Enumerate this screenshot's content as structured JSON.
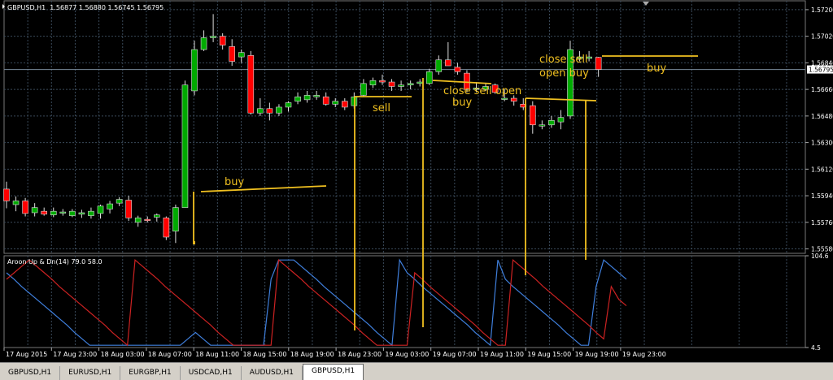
{
  "window": {
    "symbol_header": "GBPUSD,H1",
    "ohlc_header": "1.56877 1.56880 1.56745 1.56795",
    "indicator_header": "Aroon Up & Dn(14) 79.0 58.0",
    "current_price": "1.56795"
  },
  "colors": {
    "background": "#000000",
    "grid": "#3a4a5a",
    "bull": "#00aa00",
    "bear": "#ff0000",
    "aroon_up": "#3f7fdc",
    "aroon_down": "#cc2222",
    "annotation": "#f0c020",
    "text": "#ffffff"
  },
  "chart_data": [
    {
      "type": "candlestick",
      "price_axis_labels": [
        "1.57200",
        "1.57020",
        "1.56840",
        "1.56660",
        "1.56480",
        "1.56300",
        "1.56120",
        "1.55940",
        "1.55760",
        "1.55580"
      ],
      "ylim": [
        1.5555,
        1.5726
      ],
      "time_axis_labels": [
        "17 Aug 2015",
        "17 Aug 23:00",
        "18 Aug 03:00",
        "18 Aug 07:00",
        "18 Aug 11:00",
        "18 Aug 15:00",
        "18 Aug 19:00",
        "18 Aug 23:00",
        "19 Aug 03:00",
        "19 Aug 07:00",
        "19 Aug 11:00",
        "19 Aug 15:00",
        "19 Aug 19:00",
        "19 Aug 23:00"
      ],
      "candles": [
        {
          "o": 1.55985,
          "h": 1.56035,
          "l": 1.55855,
          "c": 1.55905
        },
        {
          "o": 1.5588,
          "h": 1.55935,
          "l": 1.55835,
          "c": 1.55905
        },
        {
          "o": 1.55905,
          "h": 1.55925,
          "l": 1.558,
          "c": 1.5582
        },
        {
          "o": 1.55825,
          "h": 1.5589,
          "l": 1.558,
          "c": 1.5586
        },
        {
          "o": 1.55835,
          "h": 1.5586,
          "l": 1.55805,
          "c": 1.55815
        },
        {
          "o": 1.5581,
          "h": 1.5586,
          "l": 1.55795,
          "c": 1.55835
        },
        {
          "o": 1.55825,
          "h": 1.5585,
          "l": 1.55805,
          "c": 1.5583
        },
        {
          "o": 1.55805,
          "h": 1.5585,
          "l": 1.55795,
          "c": 1.55835
        },
        {
          "o": 1.55815,
          "h": 1.55845,
          "l": 1.5579,
          "c": 1.55825
        },
        {
          "o": 1.55805,
          "h": 1.5586,
          "l": 1.55785,
          "c": 1.55835
        },
        {
          "o": 1.5582,
          "h": 1.5588,
          "l": 1.55785,
          "c": 1.5587
        },
        {
          "o": 1.5585,
          "h": 1.55905,
          "l": 1.5582,
          "c": 1.55885
        },
        {
          "o": 1.5589,
          "h": 1.5593,
          "l": 1.5587,
          "c": 1.55915
        },
        {
          "o": 1.5591,
          "h": 1.5594,
          "l": 1.5577,
          "c": 1.5579
        },
        {
          "o": 1.5576,
          "h": 1.55805,
          "l": 1.5573,
          "c": 1.5579
        },
        {
          "o": 1.5578,
          "h": 1.558,
          "l": 1.5576,
          "c": 1.55775
        },
        {
          "o": 1.55795,
          "h": 1.5582,
          "l": 1.55765,
          "c": 1.5581
        },
        {
          "o": 1.5579,
          "h": 1.558,
          "l": 1.5564,
          "c": 1.5566
        },
        {
          "o": 1.557,
          "h": 1.5588,
          "l": 1.5562,
          "c": 1.5586
        },
        {
          "o": 1.5586,
          "h": 1.5672,
          "l": 1.5586,
          "c": 1.5669
        },
        {
          "o": 1.5665,
          "h": 1.5699,
          "l": 1.5662,
          "c": 1.5693
        },
        {
          "o": 1.5693,
          "h": 1.5706,
          "l": 1.5692,
          "c": 1.5701
        },
        {
          "o": 1.5701,
          "h": 1.5717,
          "l": 1.5698,
          "c": 1.5702
        },
        {
          "o": 1.5702,
          "h": 1.5704,
          "l": 1.5693,
          "c": 1.5696
        },
        {
          "o": 1.5695,
          "h": 1.57,
          "l": 1.5682,
          "c": 1.5685
        },
        {
          "o": 1.5688,
          "h": 1.5693,
          "l": 1.5684,
          "c": 1.5691
        },
        {
          "o": 1.5689,
          "h": 1.5692,
          "l": 1.5649,
          "c": 1.565
        },
        {
          "o": 1.565,
          "h": 1.566,
          "l": 1.5648,
          "c": 1.5653
        },
        {
          "o": 1.5653,
          "h": 1.5657,
          "l": 1.5645,
          "c": 1.565
        },
        {
          "o": 1.565,
          "h": 1.5656,
          "l": 1.5648,
          "c": 1.5654
        },
        {
          "o": 1.5654,
          "h": 1.5658,
          "l": 1.5651,
          "c": 1.5657
        },
        {
          "o": 1.5658,
          "h": 1.5664,
          "l": 1.5656,
          "c": 1.5661
        },
        {
          "o": 1.5659,
          "h": 1.5665,
          "l": 1.5657,
          "c": 1.5662
        },
        {
          "o": 1.5661,
          "h": 1.5665,
          "l": 1.5659,
          "c": 1.5662
        },
        {
          "o": 1.5661,
          "h": 1.5664,
          "l": 1.5655,
          "c": 1.5656
        },
        {
          "o": 1.5656,
          "h": 1.566,
          "l": 1.5654,
          "c": 1.5658
        },
        {
          "o": 1.5658,
          "h": 1.566,
          "l": 1.5652,
          "c": 1.5654
        },
        {
          "o": 1.5655,
          "h": 1.5664,
          "l": 1.5653,
          "c": 1.5661
        },
        {
          "o": 1.5662,
          "h": 1.5673,
          "l": 1.5661,
          "c": 1.567
        },
        {
          "o": 1.5669,
          "h": 1.5674,
          "l": 1.5667,
          "c": 1.5672
        },
        {
          "o": 1.5672,
          "h": 1.5676,
          "l": 1.5669,
          "c": 1.5671
        },
        {
          "o": 1.5671,
          "h": 1.5673,
          "l": 1.5665,
          "c": 1.5668
        },
        {
          "o": 1.5668,
          "h": 1.5672,
          "l": 1.5665,
          "c": 1.5669
        },
        {
          "o": 1.5669,
          "h": 1.5672,
          "l": 1.5666,
          "c": 1.567
        },
        {
          "o": 1.567,
          "h": 1.5673,
          "l": 1.5668,
          "c": 1.5671
        },
        {
          "o": 1.567,
          "h": 1.568,
          "l": 1.5669,
          "c": 1.5678
        },
        {
          "o": 1.5678,
          "h": 1.5689,
          "l": 1.5676,
          "c": 1.5686
        },
        {
          "o": 1.5686,
          "h": 1.5698,
          "l": 1.5682,
          "c": 1.5682
        },
        {
          "o": 1.5681,
          "h": 1.5684,
          "l": 1.5676,
          "c": 1.5678
        },
        {
          "o": 1.5677,
          "h": 1.5679,
          "l": 1.5664,
          "c": 1.5666
        },
        {
          "o": 1.5666,
          "h": 1.5671,
          "l": 1.5664,
          "c": 1.5667
        },
        {
          "o": 1.5666,
          "h": 1.567,
          "l": 1.5665,
          "c": 1.5668
        },
        {
          "o": 1.5669,
          "h": 1.567,
          "l": 1.5663,
          "c": 1.5664
        },
        {
          "o": 1.566,
          "h": 1.5666,
          "l": 1.5658,
          "c": 1.566
        },
        {
          "o": 1.566,
          "h": 1.5662,
          "l": 1.5655,
          "c": 1.5658
        },
        {
          "o": 1.5656,
          "h": 1.566,
          "l": 1.5652,
          "c": 1.5654
        },
        {
          "o": 1.5655,
          "h": 1.5658,
          "l": 1.5636,
          "c": 1.5642
        },
        {
          "o": 1.5642,
          "h": 1.5645,
          "l": 1.5639,
          "c": 1.5642
        },
        {
          "o": 1.5642,
          "h": 1.5648,
          "l": 1.564,
          "c": 1.5645
        },
        {
          "o": 1.5644,
          "h": 1.5652,
          "l": 1.5639,
          "c": 1.5647
        },
        {
          "o": 1.5648,
          "h": 1.5699,
          "l": 1.5646,
          "c": 1.5693
        },
        {
          "o": 1.5687,
          "h": 1.5692,
          "l": 1.5685,
          "c": 1.5688
        },
        {
          "o": 1.5687,
          "h": 1.5692,
          "l": 1.5685,
          "c": 1.5688
        },
        {
          "o": 1.56877,
          "h": 1.5688,
          "l": 1.56745,
          "c": 1.56795
        }
      ]
    },
    {
      "type": "line",
      "scale_labels": [
        "104.6",
        "4.5"
      ],
      "ylim": [
        4.5,
        104.6
      ],
      "series": [
        {
          "name": "Aroon Up",
          "values": [
            100,
            93,
            86,
            79,
            71,
            64,
            57,
            50,
            43,
            36,
            29,
            21,
            14,
            7,
            7,
            7,
            7,
            7,
            7,
            7,
            7,
            7,
            7,
            7,
            14,
            21,
            14,
            7,
            7,
            7,
            7,
            7,
            7,
            7,
            7,
            7,
            7,
            7,
            7,
            7,
            7,
            7,
            7,
            7,
            71,
            100,
            100,
            100,
            100,
            100,
            100,
            93,
            86,
            79,
            71,
            64,
            57,
            50,
            43,
            36,
            29,
            21,
            14,
            7,
            7,
            7,
            7,
            7,
            7,
            7,
            7,
            7,
            7,
            14,
            21,
            29,
            36,
            43,
            50,
            57,
            79,
            93,
            100,
            100,
            100,
            86,
            79,
            100,
            100,
            100,
            100,
            93,
            86,
            79,
            71,
            64,
            57,
            50,
            43,
            36,
            29,
            21,
            14,
            7,
            7,
            14,
            21,
            29,
            36,
            43,
            57,
            71,
            79,
            93,
            100,
            100,
            93,
            86,
            79,
            100,
            100,
            100,
            100,
            100,
            100,
            100,
            100,
            100,
            100,
            100,
            100,
            100,
            100,
            100,
            100,
            100,
            100,
            100,
            100,
            100,
            100,
            100,
            100,
            100,
            100
          ]
        },
        {
          "name": "Aroon Down",
          "values": [
            79,
            71,
            64,
            57,
            50,
            43,
            36,
            29,
            21,
            14,
            7,
            14,
            21,
            29,
            36,
            43,
            50,
            57,
            64,
            71,
            79,
            86,
            93,
            100,
            93,
            86,
            79,
            71,
            64,
            57,
            50,
            43,
            36,
            29,
            21,
            14,
            7,
            7,
            7,
            7,
            7,
            7,
            7,
            7,
            7,
            7,
            7,
            7,
            7,
            7,
            7,
            7,
            7,
            7,
            7,
            7,
            7,
            7,
            7,
            7,
            7,
            7,
            7,
            7,
            7,
            7,
            7,
            7,
            7,
            7,
            7,
            7,
            7,
            7,
            7,
            7,
            7,
            7,
            7,
            7,
            7,
            7,
            7,
            7,
            7,
            7,
            7,
            7,
            7,
            7,
            7,
            7,
            7,
            7,
            7,
            7,
            7,
            7,
            7,
            7,
            7,
            7,
            7,
            7,
            7,
            7,
            7,
            7,
            7,
            7,
            7,
            7,
            7,
            7,
            7,
            7,
            7,
            7,
            7,
            7,
            7,
            7,
            7,
            7,
            7,
            7,
            7,
            7,
            7,
            7,
            7,
            7,
            7,
            7,
            7,
            7,
            7,
            7,
            7,
            7,
            7,
            7,
            7,
            7,
            7
          ]
        }
      ],
      "up_values": [
        86,
        79,
        71,
        64,
        57,
        50,
        43,
        36,
        29,
        21,
        14,
        7,
        7,
        7,
        7,
        7,
        7,
        7,
        7,
        7,
        7,
        7,
        7,
        7,
        14,
        21,
        14,
        7,
        7,
        7,
        7,
        7,
        7,
        7,
        7,
        79,
        100,
        100,
        100,
        93,
        86,
        79,
        71,
        64,
        57,
        50,
        43,
        36,
        29,
        21,
        14,
        7,
        100,
        86,
        79,
        71,
        64,
        57,
        50,
        43,
        36,
        29,
        21,
        14,
        7,
        100,
        79,
        71,
        64,
        57,
        50,
        43,
        36,
        29,
        21,
        14,
        7,
        7,
        71,
        100,
        93,
        86,
        79
      ],
      "down_values": [
        79,
        86,
        93,
        100,
        93,
        86,
        79,
        71,
        64,
        57,
        50,
        43,
        36,
        29,
        21,
        14,
        7,
        100,
        93,
        86,
        79,
        71,
        64,
        57,
        50,
        43,
        36,
        29,
        21,
        14,
        7,
        7,
        7,
        7,
        7,
        7,
        100,
        93,
        86,
        79,
        71,
        64,
        57,
        50,
        43,
        36,
        29,
        21,
        14,
        7,
        7,
        7,
        7,
        7,
        86,
        79,
        71,
        64,
        57,
        50,
        43,
        36,
        29,
        21,
        14,
        7,
        7,
        100,
        93,
        86,
        79,
        71,
        64,
        57,
        50,
        43,
        36,
        29,
        21,
        14,
        71,
        57,
        50
      ]
    }
  ],
  "annotations": [
    {
      "id": "buy-1",
      "text": "buy"
    },
    {
      "id": "sell-1",
      "text": "sell"
    },
    {
      "id": "close-sell-1a",
      "text": "close sell open"
    },
    {
      "id": "close-sell-1b",
      "text": "buy"
    },
    {
      "id": "close-sell-2a",
      "text": "close sell"
    },
    {
      "id": "close-sell-2b",
      "text": "open buy"
    },
    {
      "id": "buy-2",
      "text": "buy"
    }
  ],
  "tabs": [
    {
      "label": "GBPUSD,H1",
      "active": false
    },
    {
      "label": "EURUSD,H1",
      "active": false
    },
    {
      "label": "EURGBP,H1",
      "active": false
    },
    {
      "label": "USDCAD,H1",
      "active": false
    },
    {
      "label": "AUDUSD,H1",
      "active": false
    },
    {
      "label": "GBPUSD,H1",
      "active": true
    }
  ]
}
